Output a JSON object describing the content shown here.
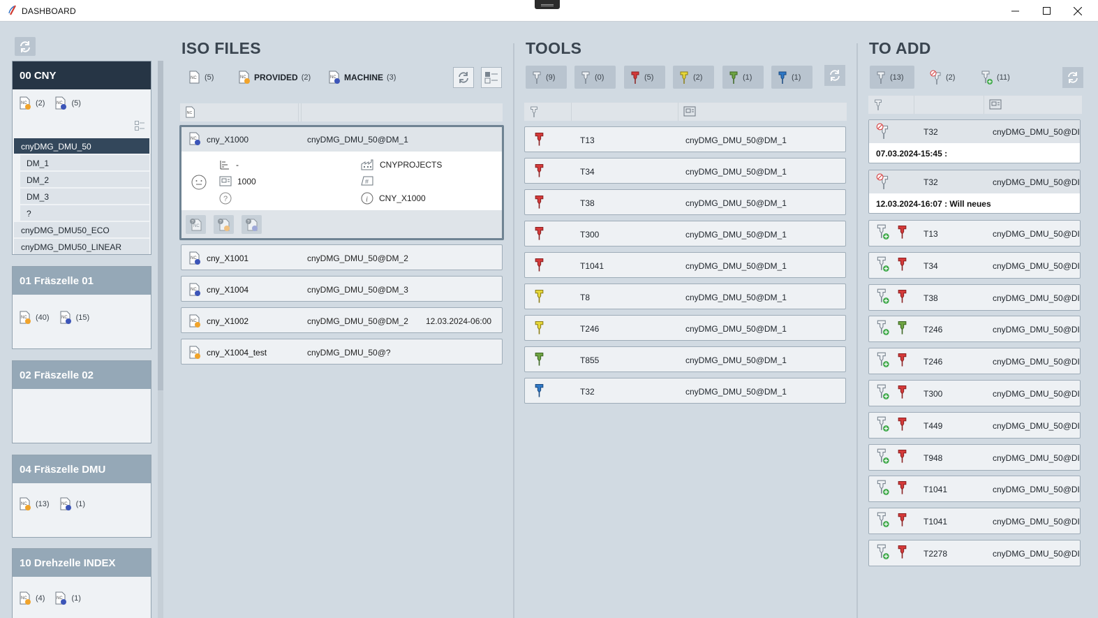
{
  "window": {
    "title": "DASHBOARD"
  },
  "colors": {
    "active_group": "#263545",
    "group_head": "#95a8b7",
    "red_tool": "#d43a3a",
    "yellow_tool": "#e6d73a",
    "green_tool": "#6fa443",
    "blue_tool": "#2f78c6"
  },
  "groups": [
    {
      "name": "00 CNY",
      "active": true,
      "count_provided": "(2)",
      "count_machine": "(5)",
      "machines": [
        {
          "name": "cnyDMG_DMU_50",
          "selected": true
        },
        {
          "name": "DM_1",
          "sub": true
        },
        {
          "name": "DM_2",
          "sub": true
        },
        {
          "name": "DM_3",
          "sub": true
        },
        {
          "name": "?",
          "sub": true
        },
        {
          "name": "cnyDMG_DMU50_ECO"
        },
        {
          "name": "cnyDMG_DMU50_LINEAR"
        }
      ]
    },
    {
      "name": "01 Fräszelle 01",
      "count_provided": "(40)",
      "count_machine": "(15)"
    },
    {
      "name": "02 Fräszelle 02"
    },
    {
      "name": "04 Fräszelle DMU",
      "count_provided": "(13)",
      "count_machine": "(1)"
    },
    {
      "name": "10 Drehzelle INDEX",
      "count_provided": "(4)",
      "count_machine": "(1)"
    }
  ],
  "iso": {
    "title": "ISO FILES",
    "filter_all_count": "(5)",
    "filter_provided_label": "PROVIDED",
    "filter_provided_count": "(2)",
    "filter_machine_label": "MACHINE",
    "filter_machine_count": "(3)",
    "expanded": {
      "name": "cny_X1000",
      "machine": "cnyDMG_DMU_50@DM_1",
      "dash": "-",
      "value": "1000",
      "project": "CNYPROJECTS",
      "info": "CNY_X1000"
    },
    "rows": [
      {
        "name": "cny_X1001",
        "machine": "cnyDMG_DMU_50@DM_2",
        "date": "",
        "status": "machine"
      },
      {
        "name": "cny_X1004",
        "machine": "cnyDMG_DMU_50@DM_3",
        "date": "",
        "status": "machine"
      },
      {
        "name": "cny_X1002",
        "machine": "cnyDMG_DMU_50@DM_2",
        "date": "12.03.2024-06:00",
        "status": "provided"
      },
      {
        "name": "cny_X1004_test",
        "machine": "cnyDMG_DMU_50@?",
        "date": "",
        "status": "provided"
      }
    ]
  },
  "tools": {
    "title": "TOOLS",
    "filters": [
      {
        "color": "gray",
        "count": "(9)"
      },
      {
        "color": "gray",
        "count": "(0)"
      },
      {
        "color": "red",
        "count": "(5)"
      },
      {
        "color": "yellow",
        "count": "(2)"
      },
      {
        "color": "green",
        "count": "(1)"
      },
      {
        "color": "blue",
        "count": "(1)"
      }
    ],
    "rows": [
      {
        "color": "red",
        "tool": "T13",
        "machine": "cnyDMG_DMU_50@DM_1"
      },
      {
        "color": "red",
        "tool": "T34",
        "machine": "cnyDMG_DMU_50@DM_1"
      },
      {
        "color": "red",
        "tool": "T38",
        "machine": "cnyDMG_DMU_50@DM_1"
      },
      {
        "color": "red",
        "tool": "T300",
        "machine": "cnyDMG_DMU_50@DM_1"
      },
      {
        "color": "red",
        "tool": "T1041",
        "machine": "cnyDMG_DMU_50@DM_1"
      },
      {
        "color": "yellow",
        "tool": "T8",
        "machine": "cnyDMG_DMU_50@DM_1"
      },
      {
        "color": "yellow",
        "tool": "T246",
        "machine": "cnyDMG_DMU_50@DM_1"
      },
      {
        "color": "green",
        "tool": "T855",
        "machine": "cnyDMG_DMU_50@DM_1"
      },
      {
        "color": "blue",
        "tool": "T32",
        "machine": "cnyDMG_DMU_50@DM_1"
      }
    ]
  },
  "to_add": {
    "title": "TO ADD",
    "filter_all_count": "(13)",
    "filter_remove_count": "(2)",
    "filter_add_count": "(11)",
    "notes": [
      {
        "tool": "T32",
        "machine": "cnyDMG_DMU_50@DI",
        "note": "07.03.2024-15:45 :"
      },
      {
        "tool": "T32",
        "machine": "cnyDMG_DMU_50@DI",
        "note": "12.03.2024-16:07 : Will neues"
      }
    ],
    "rows": [
      {
        "color": "red",
        "tool": "T13",
        "machine": "cnyDMG_DMU_50@DI"
      },
      {
        "color": "red",
        "tool": "T34",
        "machine": "cnyDMG_DMU_50@DI"
      },
      {
        "color": "red",
        "tool": "T38",
        "machine": "cnyDMG_DMU_50@DI"
      },
      {
        "color": "green",
        "tool": "T246",
        "machine": "cnyDMG_DMU_50@DI"
      },
      {
        "color": "red",
        "tool": "T246",
        "machine": "cnyDMG_DMU_50@DI"
      },
      {
        "color": "red",
        "tool": "T300",
        "machine": "cnyDMG_DMU_50@DI"
      },
      {
        "color": "red",
        "tool": "T449",
        "machine": "cnyDMG_DMU_50@DI"
      },
      {
        "color": "red",
        "tool": "T948",
        "machine": "cnyDMG_DMU_50@DI"
      },
      {
        "color": "red",
        "tool": "T1041",
        "machine": "cnyDMG_DMU_50@DI"
      },
      {
        "color": "red",
        "tool": "T1041",
        "machine": "cnyDMG_DMU_50@DI"
      },
      {
        "color": "red",
        "tool": "T2278",
        "machine": "cnyDMG_DMU_50@DI"
      }
    ]
  }
}
